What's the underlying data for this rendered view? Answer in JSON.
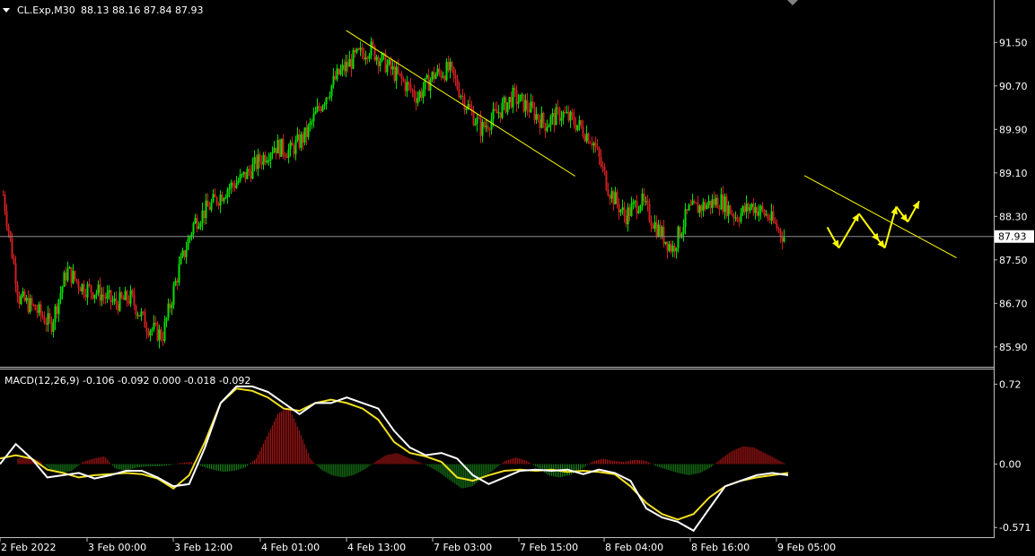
{
  "chart_data": [
    {
      "type": "candlestick",
      "header": {
        "symbol": "CL.Exp,M30",
        "ohlc": "88.13 88.16 87.84 87.93"
      },
      "y_ticks": [
        "91.50",
        "90.70",
        "89.90",
        "89.10",
        "88.30",
        "87.50",
        "86.70",
        "85.90"
      ],
      "y_tick_values": [
        91.5,
        90.7,
        89.9,
        89.1,
        88.3,
        87.5,
        86.7,
        85.9
      ],
      "ylim": [
        85.6,
        91.95
      ],
      "current_price": 87.93,
      "current_price_label": "87.93",
      "x_labels": [
        "2 Feb 2022",
        "3 Feb 00:00",
        "3 Feb 12:00",
        "4 Feb 01:00",
        "4 Feb 13:00",
        "7 Feb 03:00",
        "7 Feb 15:00",
        "8 Feb 04:00",
        "8 Feb 16:00",
        "9 Feb 05:00"
      ],
      "close_path": [
        88.7,
        86.8,
        86.6,
        86.3,
        87.3,
        87.0,
        86.9,
        86.7,
        86.8,
        86.3,
        86.1,
        87.3,
        88.2,
        88.5,
        88.8,
        89.0,
        89.3,
        89.6,
        89.5,
        89.8,
        90.4,
        90.9,
        91.2,
        91.4,
        91.1,
        90.8,
        90.5,
        90.9,
        91.0,
        90.4,
        89.9,
        90.2,
        90.5,
        90.3,
        90.0,
        90.2,
        90.0,
        89.7,
        88.8,
        88.3,
        88.6,
        88.1,
        87.7,
        88.4,
        88.5,
        88.6,
        88.3,
        88.5,
        88.3,
        87.93
      ],
      "trendlines": [
        {
          "from": [
            12,
            91.72
          ],
          "to": [
            20.0,
            89.04
          ]
        },
        {
          "from": [
            28.0,
            89.05
          ],
          "to": [
            33.3,
            87.54
          ]
        }
      ],
      "forecast_path": [
        [
          28.8,
          88.1
        ],
        [
          29.2,
          87.72
        ],
        [
          29.9,
          88.35
        ],
        [
          30.6,
          87.85
        ],
        [
          30.8,
          87.72
        ],
        [
          31.2,
          88.48
        ],
        [
          31.6,
          88.2
        ],
        [
          32.0,
          88.58
        ]
      ],
      "x_label_positions": [
        0,
        1,
        2,
        3,
        4,
        5,
        6,
        7,
        8,
        9
      ]
    },
    {
      "type": "macd",
      "label": "MACD(12,26,9) -0.106 -0.092 0.000 -0.018 -0.092",
      "y_ticks": [
        "0.72",
        "0.00",
        "-0.571"
      ],
      "y_tick_values": [
        0.72,
        0.0,
        -0.571
      ],
      "ylim": [
        -0.65,
        0.82
      ],
      "histogram": [
        0.05,
        0.06,
        0.03,
        -0.05,
        -0.08,
        -0.06,
        0.02,
        0.05,
        0.07,
        -0.04,
        -0.06,
        -0.03,
        -0.02,
        -0.02,
        -0.01,
        0.01,
        0.02,
        -0.02,
        -0.05,
        -0.07,
        -0.06,
        -0.03,
        0.05,
        0.25,
        0.45,
        0.52,
        0.3,
        0.05,
        -0.05,
        -0.1,
        -0.12,
        -0.1,
        -0.05,
        0.02,
        0.08,
        0.1,
        0.06,
        0.02,
        -0.02,
        -0.08,
        -0.15,
        -0.22,
        -0.2,
        -0.12,
        -0.05,
        0.03,
        0.06,
        0.03,
        -0.03,
        -0.1,
        -0.12,
        -0.1,
        -0.05,
        0.02,
        0.05,
        0.03,
        0.02,
        0.04,
        0.03,
        -0.02,
        -0.05,
        -0.08,
        -0.1,
        -0.08,
        -0.03,
        0.05,
        0.12,
        0.16,
        0.15,
        0.1,
        0.05,
        0.0
      ],
      "macd_line": [
        0.0,
        0.18,
        0.05,
        -0.12,
        -0.1,
        -0.08,
        -0.13,
        -0.1,
        -0.06,
        -0.06,
        -0.12,
        -0.2,
        -0.18,
        0.15,
        0.55,
        0.7,
        0.7,
        0.65,
        0.55,
        0.45,
        0.55,
        0.55,
        0.6,
        0.55,
        0.5,
        0.3,
        0.15,
        0.08,
        0.1,
        0.05,
        -0.1,
        -0.18,
        -0.12,
        -0.06,
        -0.05,
        -0.06,
        -0.05,
        -0.09,
        -0.05,
        -0.08,
        -0.15,
        -0.4,
        -0.48,
        -0.52,
        -0.6,
        -0.4,
        -0.2,
        -0.15,
        -0.1,
        -0.08,
        -0.1
      ],
      "signal_line": [
        0.05,
        0.08,
        0.05,
        -0.05,
        -0.08,
        -0.12,
        -0.1,
        -0.09,
        -0.08,
        -0.09,
        -0.13,
        -0.22,
        -0.1,
        0.2,
        0.55,
        0.68,
        0.66,
        0.6,
        0.5,
        0.48,
        0.55,
        0.58,
        0.55,
        0.5,
        0.4,
        0.2,
        0.1,
        0.07,
        0.02,
        -0.12,
        -0.15,
        -0.1,
        -0.06,
        -0.05,
        -0.06,
        -0.05,
        -0.07,
        -0.06,
        -0.07,
        -0.09,
        -0.2,
        -0.35,
        -0.45,
        -0.5,
        -0.45,
        -0.3,
        -0.2,
        -0.15,
        -0.12,
        -0.1,
        -0.08
      ]
    }
  ],
  "colors": {
    "background": "#000000",
    "bull": "#00e000",
    "bear": "#d02020",
    "trendline": "#ffff00",
    "grid": "#c0c0c0",
    "macd_line": "#ffffff",
    "signal_line": "#f0e020",
    "hist_pos": "#c01818",
    "hist_neg": "#1a8a1a",
    "price_box": "#ffffff"
  },
  "icons": {
    "menu": "triangle-down-icon",
    "scroll_marker": "triangle-down-icon"
  }
}
